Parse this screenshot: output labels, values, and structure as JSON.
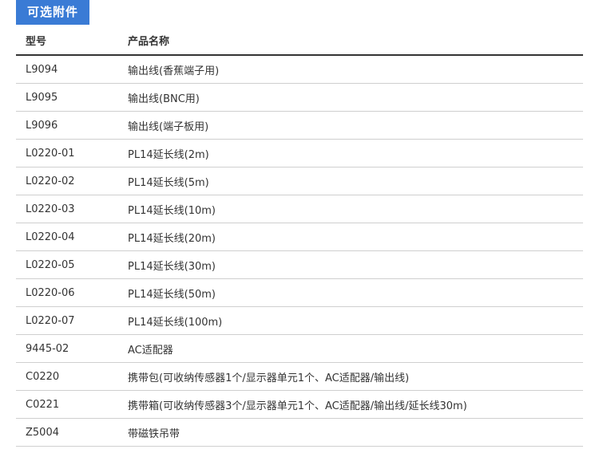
{
  "section": {
    "title": "可选附件"
  },
  "table": {
    "headers": {
      "model": "型号",
      "name": "产品名称"
    },
    "rows": [
      {
        "model": "L9094",
        "name": "输出线(香蕉端子用)"
      },
      {
        "model": "L9095",
        "name": "输出线(BNC用)"
      },
      {
        "model": "L9096",
        "name": "输出线(端子板用)"
      },
      {
        "model": "L0220-01",
        "name": "PL14延长线(2m)"
      },
      {
        "model": "L0220-02",
        "name": "PL14延长线(5m)"
      },
      {
        "model": "L0220-03",
        "name": "PL14延长线(10m)"
      },
      {
        "model": "L0220-04",
        "name": "PL14延长线(20m)"
      },
      {
        "model": "L0220-05",
        "name": "PL14延长线(30m)"
      },
      {
        "model": "L0220-06",
        "name": "PL14延长线(50m)"
      },
      {
        "model": "L0220-07",
        "name": "PL14延长线(100m)"
      },
      {
        "model": "9445-02",
        "name": "AC适配器"
      },
      {
        "model": "C0220",
        "name": "携带包(可收纳传感器1个/显示器单元1个、AC适配器/输出线)"
      },
      {
        "model": "C0221",
        "name": "携带箱(可收纳传感器3个/显示器单元1个、AC适配器/输出线/延长线30m)"
      },
      {
        "model": "Z5004",
        "name": "带磁铁吊带"
      }
    ]
  },
  "colors": {
    "accent": "#3a7bd5",
    "text": "#333333",
    "divider": "#cfcfcf"
  }
}
